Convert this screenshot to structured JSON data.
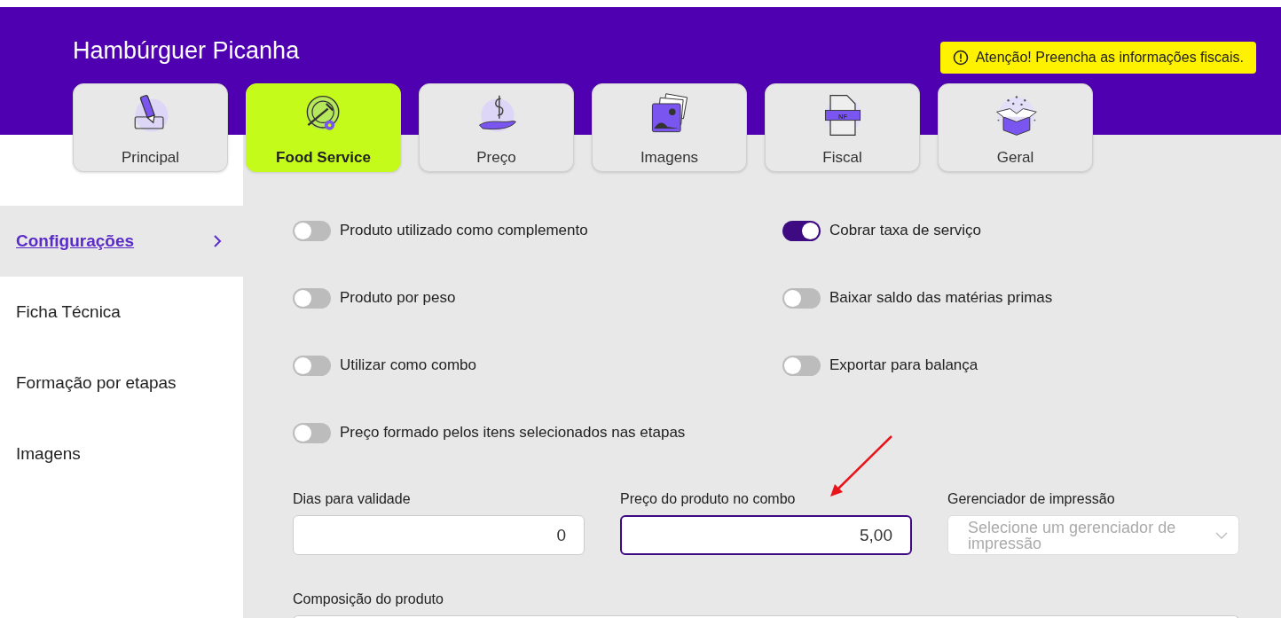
{
  "title": "Hambúrguer Picanha",
  "alert": {
    "text": "Atenção! Preencha as informações fiscais."
  },
  "tabs": [
    {
      "label": "Principal",
      "selected": false
    },
    {
      "label": "Food Service",
      "selected": true
    },
    {
      "label": "Preço",
      "selected": false
    },
    {
      "label": "Imagens",
      "selected": false
    },
    {
      "label": "Fiscal",
      "icon_text": "NF",
      "selected": false
    },
    {
      "label": "Geral",
      "selected": false
    }
  ],
  "sidebar": {
    "items": [
      {
        "label": "Configurações",
        "selected": true
      },
      {
        "label": "Ficha Técnica",
        "selected": false
      },
      {
        "label": "Formação por etapas",
        "selected": false
      },
      {
        "label": "Imagens",
        "selected": false
      }
    ]
  },
  "toggles": [
    {
      "label": "Produto utilizado como complemento",
      "on": false
    },
    {
      "label": "Cobrar taxa de serviço",
      "on": true
    },
    {
      "label": "Produto por peso",
      "on": false
    },
    {
      "label": "Baixar saldo das matérias primas",
      "on": false
    },
    {
      "label": "Utilizar como combo",
      "on": false
    },
    {
      "label": "Exportar para balança",
      "on": false
    },
    {
      "label": "Preço formado pelos itens selecionados nas etapas",
      "on": false
    }
  ],
  "fields": [
    {
      "kind": "input",
      "label": "Dias para validade",
      "value": "0",
      "focused": false
    },
    {
      "kind": "input",
      "label": "Preço do produto no combo",
      "value": "5,00",
      "focused": true
    },
    {
      "kind": "select",
      "label": "Gerenciador de impressão",
      "placeholder": "Selecione um gerenciador de impressão"
    }
  ],
  "composition": {
    "label": "Composição do produto"
  }
}
